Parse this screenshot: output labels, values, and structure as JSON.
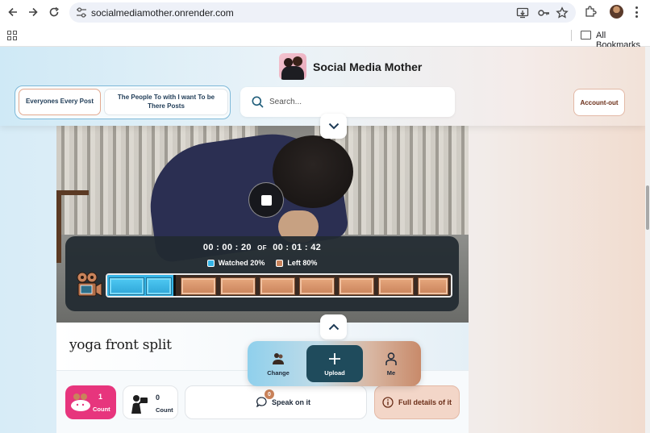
{
  "browser": {
    "url": "socialmediamother.onrender.com",
    "bookmarks_label": "All Bookmarks"
  },
  "header": {
    "site_title": "Social Media Mother",
    "tabs": [
      {
        "label": "Everyones Every Post",
        "active": true
      },
      {
        "label": "The People To with I want To be There Posts",
        "active": false
      }
    ],
    "search_placeholder": "Search...",
    "account_label": "Account-out"
  },
  "player": {
    "elapsed": "00 : 00 : 20",
    "of_label": "OF",
    "total": "00 : 01 : 42",
    "watched_label": "Watched 20%",
    "left_label": "Left 80%",
    "watched_fraction": 0.2,
    "watched_color": "#35b5e7",
    "left_color": "#c9835b"
  },
  "post": {
    "title": "yoga front split",
    "likes": {
      "count": "1",
      "label": "Count"
    },
    "views": {
      "count": "0",
      "label": "Count"
    },
    "comments_badge": "0",
    "speak_label": "Speak on it",
    "details_label": "Full details of it"
  },
  "fab": {
    "change_label": "Change",
    "upload_label": "Upload",
    "me_label": "Me"
  },
  "colors": {
    "accent_pink": "#e7357d",
    "upload_dark": "#1f4b5c",
    "account_text": "#6b2e18"
  }
}
